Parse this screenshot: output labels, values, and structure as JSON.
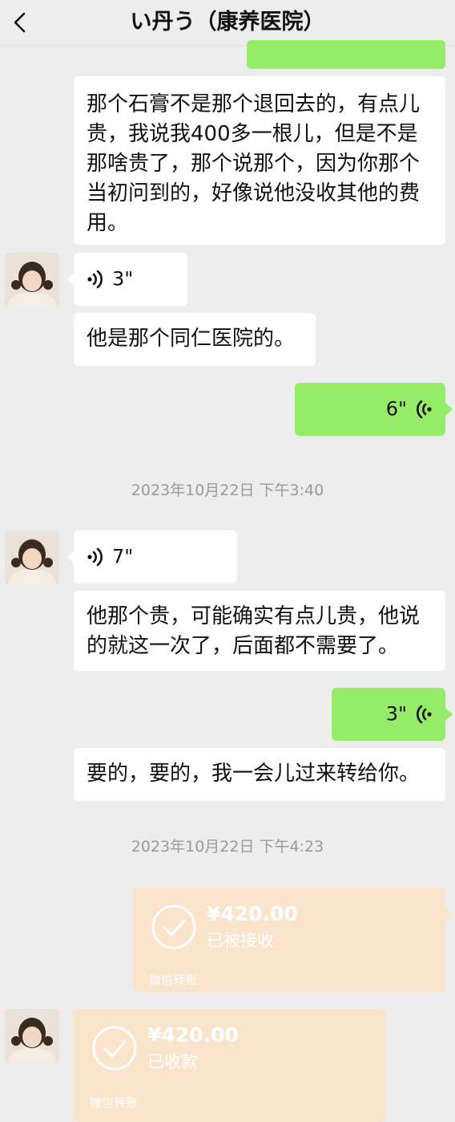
{
  "header": {
    "title": "い丹う（康养医院）"
  },
  "messages": {
    "m1_text": "那个石膏不是那个退回去的，有点儿贵，我说我400多一根儿，但是不是那啥贵了，那个说那个，因为你那个当初问到的，好像说他没收其他的费用。",
    "m2_voice": "3\"",
    "m3_text": "他是那个同仁医院的。",
    "m4_voice": "6\"",
    "m5_voice": "7\"",
    "m6_text": "他那个贵，可能确实有点儿贵，他说的就这一次了，后面都不需要了。",
    "m7_voice": "3\"",
    "m8_text": "要的，要的，我一会儿过来转给你。"
  },
  "timestamps": {
    "t1": "2023年10月22日 下午3:40",
    "t2": "2023年10月22日 下午4:23"
  },
  "transfers": {
    "sent": {
      "amount": "¥420.00",
      "status": "已被接收",
      "label": "微信转账"
    },
    "received": {
      "amount": "¥420.00",
      "status": "已收款",
      "label": "微信转账"
    }
  },
  "colors": {
    "background": "#ededed",
    "own_bubble": "#95ec69",
    "other_bubble": "#ffffff",
    "transfer_card": "#fae4cc",
    "timestamp_text": "#9a9a9a"
  }
}
